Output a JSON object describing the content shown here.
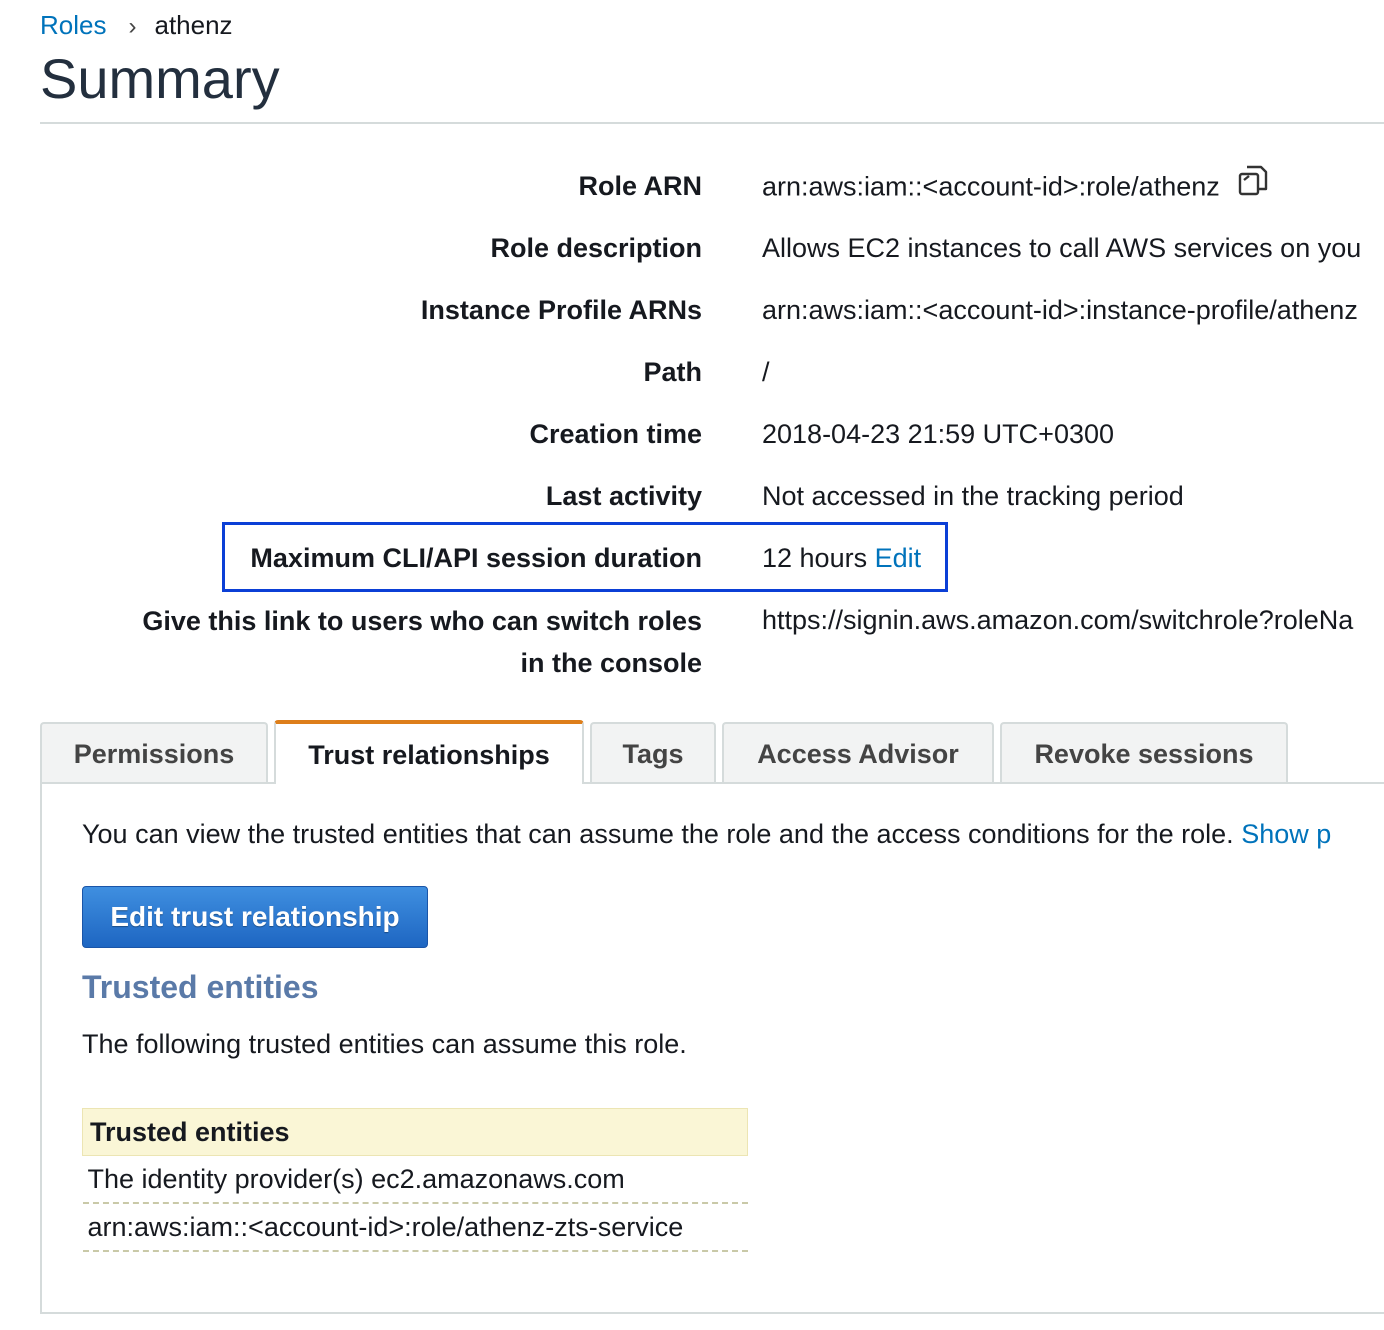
{
  "breadcrumb": {
    "parent": "Roles",
    "separator": "›",
    "current": "athenz"
  },
  "page_title": "Summary",
  "summary_rows": [
    {
      "label": "Role ARN",
      "value": "arn:aws:iam::<account-id>:role/athenz"
    },
    {
      "label": "Role description",
      "value": "Allows EC2 instances to call AWS services on you"
    },
    {
      "label": "Instance Profile ARNs",
      "value": "arn:aws:iam::<account-id>:instance-profile/athenz"
    },
    {
      "label": "Path",
      "value": "/"
    },
    {
      "label": "Creation time",
      "value": "2018-04-23 21:59 UTC+0300"
    },
    {
      "label": "Last activity",
      "value": "Not accessed in the tracking period"
    },
    {
      "label": "Maximum CLI/API session duration",
      "value": "12 hours",
      "link": "Edit"
    },
    {
      "label_line1": "Give this link to users who can switch roles",
      "label_line2": "in the console",
      "value": "https://signin.aws.amazon.com/switchrole?roleNa"
    }
  ],
  "icons": {
    "copy": "copy-icon"
  },
  "colors": {
    "link": "#0073bb",
    "highlight_border": "#0b3fd6",
    "active_tab_accent": "#dd7e1a",
    "primary_button": "#1e66c2",
    "table_header_bg": "#faf6d6"
  },
  "tabs": [
    {
      "label": "Permissions",
      "active": false
    },
    {
      "label": "Trust relationships",
      "active": true
    },
    {
      "label": "Tags",
      "active": false
    },
    {
      "label": "Access Advisor",
      "active": false
    },
    {
      "label": "Revoke sessions",
      "active": false
    }
  ],
  "trust": {
    "intro": "You can view the trusted entities that can assume the role and the access conditions for the role.",
    "intro_link": "Show p",
    "edit_button": "Edit trust relationship",
    "section_title": "Trusted entities",
    "description": "The following trusted entities can assume this role.",
    "table_header": "Trusted entities",
    "rows": [
      "The identity provider(s) ec2.amazonaws.com",
      "arn:aws:iam::<account-id>:role/athenz-zts-service"
    ]
  }
}
